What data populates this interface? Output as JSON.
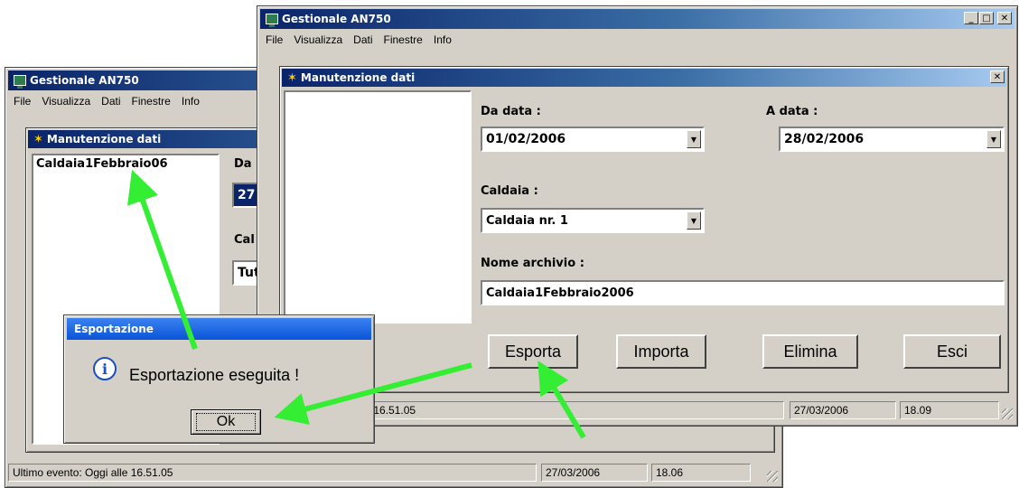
{
  "back_window": {
    "title": "Gestionale AN750",
    "menu": [
      "File",
      "Visualizza",
      "Dati",
      "Finestre",
      "Info"
    ],
    "child_title": "Manutenzione dati",
    "list_item": "Caldaia1Febbraio06",
    "label_partial_1": "Da",
    "value_partial_1": "27",
    "label_partial_2": "Cal",
    "value_partial_2": "Tut",
    "status_text": "Ultimo evento: Oggi alle 16.51.05",
    "status_date": "27/03/2006",
    "status_time": "18.06"
  },
  "front_window": {
    "title": "Gestionale AN750",
    "menu": [
      "File",
      "Visualizza",
      "Dati",
      "Finestre",
      "Info"
    ],
    "child_title": "Manutenzione dati",
    "from_label": "Da data :",
    "from_value": "01/02/2006",
    "to_label": "A data :",
    "to_value": "28/02/2006",
    "boiler_label": "Caldaia :",
    "boiler_value": "Caldaia nr. 1",
    "archive_label": "Nome archivio :",
    "archive_value": "Caldaia1Febbraio2006",
    "buttons": [
      "Esporta",
      "Importa",
      "Elimina",
      "Esci"
    ],
    "status_text": "lle 16.51.05",
    "status_date": "27/03/2006",
    "status_time": "18.09"
  },
  "dialog": {
    "title": "Esportazione",
    "message": "Esportazione eseguita !",
    "ok_label": "Ok"
  },
  "colors": {
    "arrow": "#33ee33",
    "titlebar": "#0a246a"
  }
}
